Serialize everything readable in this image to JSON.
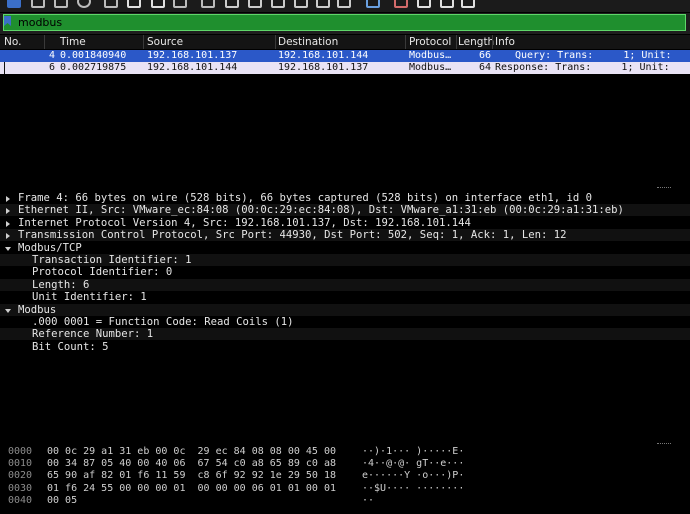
{
  "filter": {
    "value": "modbus"
  },
  "columns": [
    "No.",
    "Time",
    "Source",
    "Destination",
    "Protocol",
    "Length",
    "Info"
  ],
  "packets": [
    {
      "no": "4",
      "time": "0.001840940",
      "source": "192.168.101.137",
      "destination": "192.168.101.144",
      "protocol": "Modbus…",
      "length": "66",
      "info": "Query: Trans:     1; Unit:"
    },
    {
      "no": "6",
      "time": "0.002719875",
      "source": "192.168.101.144",
      "destination": "192.168.101.137",
      "protocol": "Modbus…",
      "length": "64",
      "info": "Response: Trans:     1; Unit:"
    }
  ],
  "details": [
    {
      "text": "Frame 4: 66 bytes on wire (528 bits), 66 bytes captured (528 bits) on interface eth1, id 0",
      "arrow": "right",
      "indent": 0
    },
    {
      "text": "Ethernet II, Src: VMware_ec:84:08 (00:0c:29:ec:84:08), Dst: VMware_a1:31:eb (00:0c:29:a1:31:eb)",
      "arrow": "right",
      "indent": 0
    },
    {
      "text": "Internet Protocol Version 4, Src: 192.168.101.137, Dst: 192.168.101.144",
      "arrow": "right",
      "indent": 0
    },
    {
      "text": "Transmission Control Protocol, Src Port: 44930, Dst Port: 502, Seq: 1, Ack: 1, Len: 12",
      "arrow": "right",
      "indent": 0
    },
    {
      "text": "Modbus/TCP",
      "arrow": "down",
      "indent": 0
    },
    {
      "text": "Transaction Identifier: 1",
      "arrow": "",
      "indent": 1
    },
    {
      "text": "Protocol Identifier: 0",
      "arrow": "",
      "indent": 1
    },
    {
      "text": "Length: 6",
      "arrow": "",
      "indent": 1
    },
    {
      "text": "Unit Identifier: 1",
      "arrow": "",
      "indent": 1
    },
    {
      "text": "Modbus",
      "arrow": "down",
      "indent": 0
    },
    {
      "text": ".000 0001 = Function Code: Read Coils (1)",
      "arrow": "",
      "indent": 1
    },
    {
      "text": "Reference Number: 1",
      "arrow": "",
      "indent": 1
    },
    {
      "text": "Bit Count: 5",
      "arrow": "",
      "indent": 1
    }
  ],
  "hex": [
    {
      "offset": "0000",
      "bytes": "00 0c 29 a1 31 eb 00 0c  29 ec 84 08 08 00 45 00",
      "ascii": "··)·1··· )·····E·"
    },
    {
      "offset": "0010",
      "bytes": "00 34 87 05 40 00 40 06  67 54 c0 a8 65 89 c0 a8",
      "ascii": "·4··@·@· gT··e···"
    },
    {
      "offset": "0020",
      "bytes": "65 90 af 82 01 f6 11 59  c8 6f 92 92 1e 29 50 18",
      "ascii": "e······Y ·o···)P·"
    },
    {
      "offset": "0030",
      "bytes": "01 f6 24 55 00 00 00 01  00 00 00 06 01 01 00 01",
      "ascii": "··$U···· ········"
    },
    {
      "offset": "0040",
      "bytes": "00 05",
      "ascii": "··"
    }
  ],
  "colors": {
    "selected_row": "#2b58c8",
    "second_row": "#e9e3f5",
    "filter_valid": "#1f8f2e"
  },
  "icons": [
    "shark-fin-icon",
    "stop-icon",
    "restart-icon",
    "options-icon",
    "open-icon",
    "save-icon",
    "close-file-icon",
    "reload-icon",
    "search-icon",
    "back-icon",
    "forward-icon",
    "go-to-icon",
    "first-icon",
    "last-icon",
    "autoscroll-icon",
    "colorize-icon",
    "zoom-in-icon",
    "zoom-out-icon",
    "normal-size-icon",
    "resize-columns-icon"
  ]
}
